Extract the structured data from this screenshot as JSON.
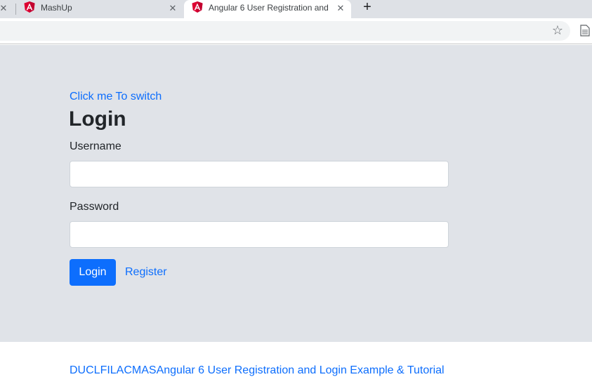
{
  "browser": {
    "tabs": [
      {
        "title": "MashUp",
        "active": false
      },
      {
        "title": "Angular 6 User Registration and",
        "active": true
      }
    ],
    "close_glyph": "✕",
    "newtab_glyph": "+",
    "star_glyph": "☆"
  },
  "page": {
    "switch_link": "Click me To switch",
    "title": "Login",
    "username_label": "Username",
    "username_value": "",
    "password_label": "Password",
    "password_value": "",
    "login_button": "Login",
    "register_link": "Register",
    "footer_link": "DUCLFILACMASAngular 6 User Registration and Login Example & Tutorial"
  },
  "colors": {
    "accent": "#0d6efd",
    "jumbotron": "#e0e3e8",
    "angular_red": "#dd0031"
  }
}
